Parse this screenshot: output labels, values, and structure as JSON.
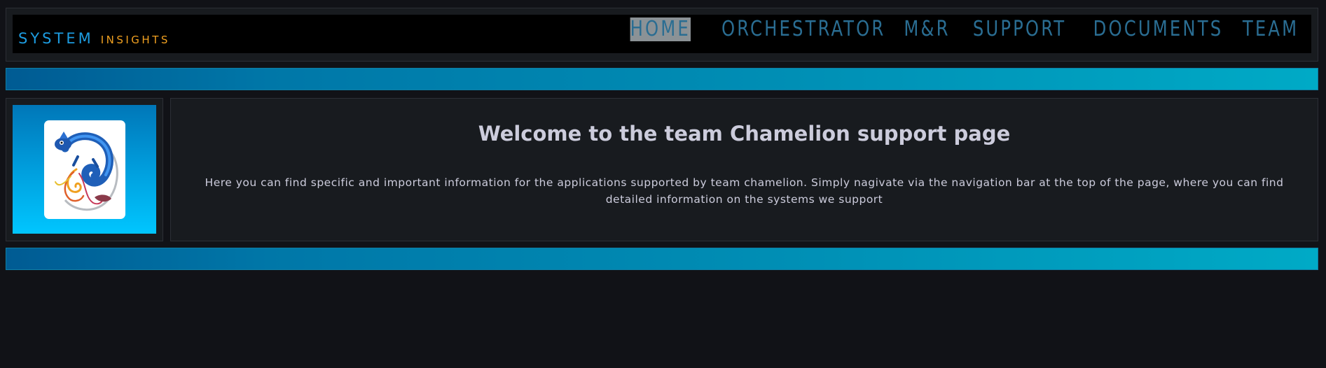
{
  "brand": {
    "system": "SYSTEM",
    "insights": "INSIGHTS"
  },
  "nav": {
    "items": [
      {
        "label": "HOME",
        "active": true
      },
      {
        "label": "ORCHESTRATOR",
        "active": false
      },
      {
        "label": "M&R",
        "active": false
      },
      {
        "label": "SUPPORT",
        "active": false
      },
      {
        "label": "DOCUMENTS",
        "active": false
      },
      {
        "label": "TEAM",
        "active": false
      }
    ]
  },
  "main": {
    "title": "Welcome to the team Chamelion support page",
    "description": "Here you can find specific and important information for the applications supported by team chamelion. Simply nagivate via the navigation bar at the top of the page, where you can find detailed information on the systems we support"
  },
  "colors": {
    "background": "#111217",
    "panel": "#181b1f",
    "brand_system": "#1d9ce0",
    "brand_insights": "#f0a020",
    "nav_text": "#2a6d92",
    "nav_active_bg": "#8b9296",
    "band_start": "#005b93",
    "band_end": "#00aac6",
    "text": "#ccccdc"
  },
  "icons": {
    "logo": "chameleon-logo"
  }
}
